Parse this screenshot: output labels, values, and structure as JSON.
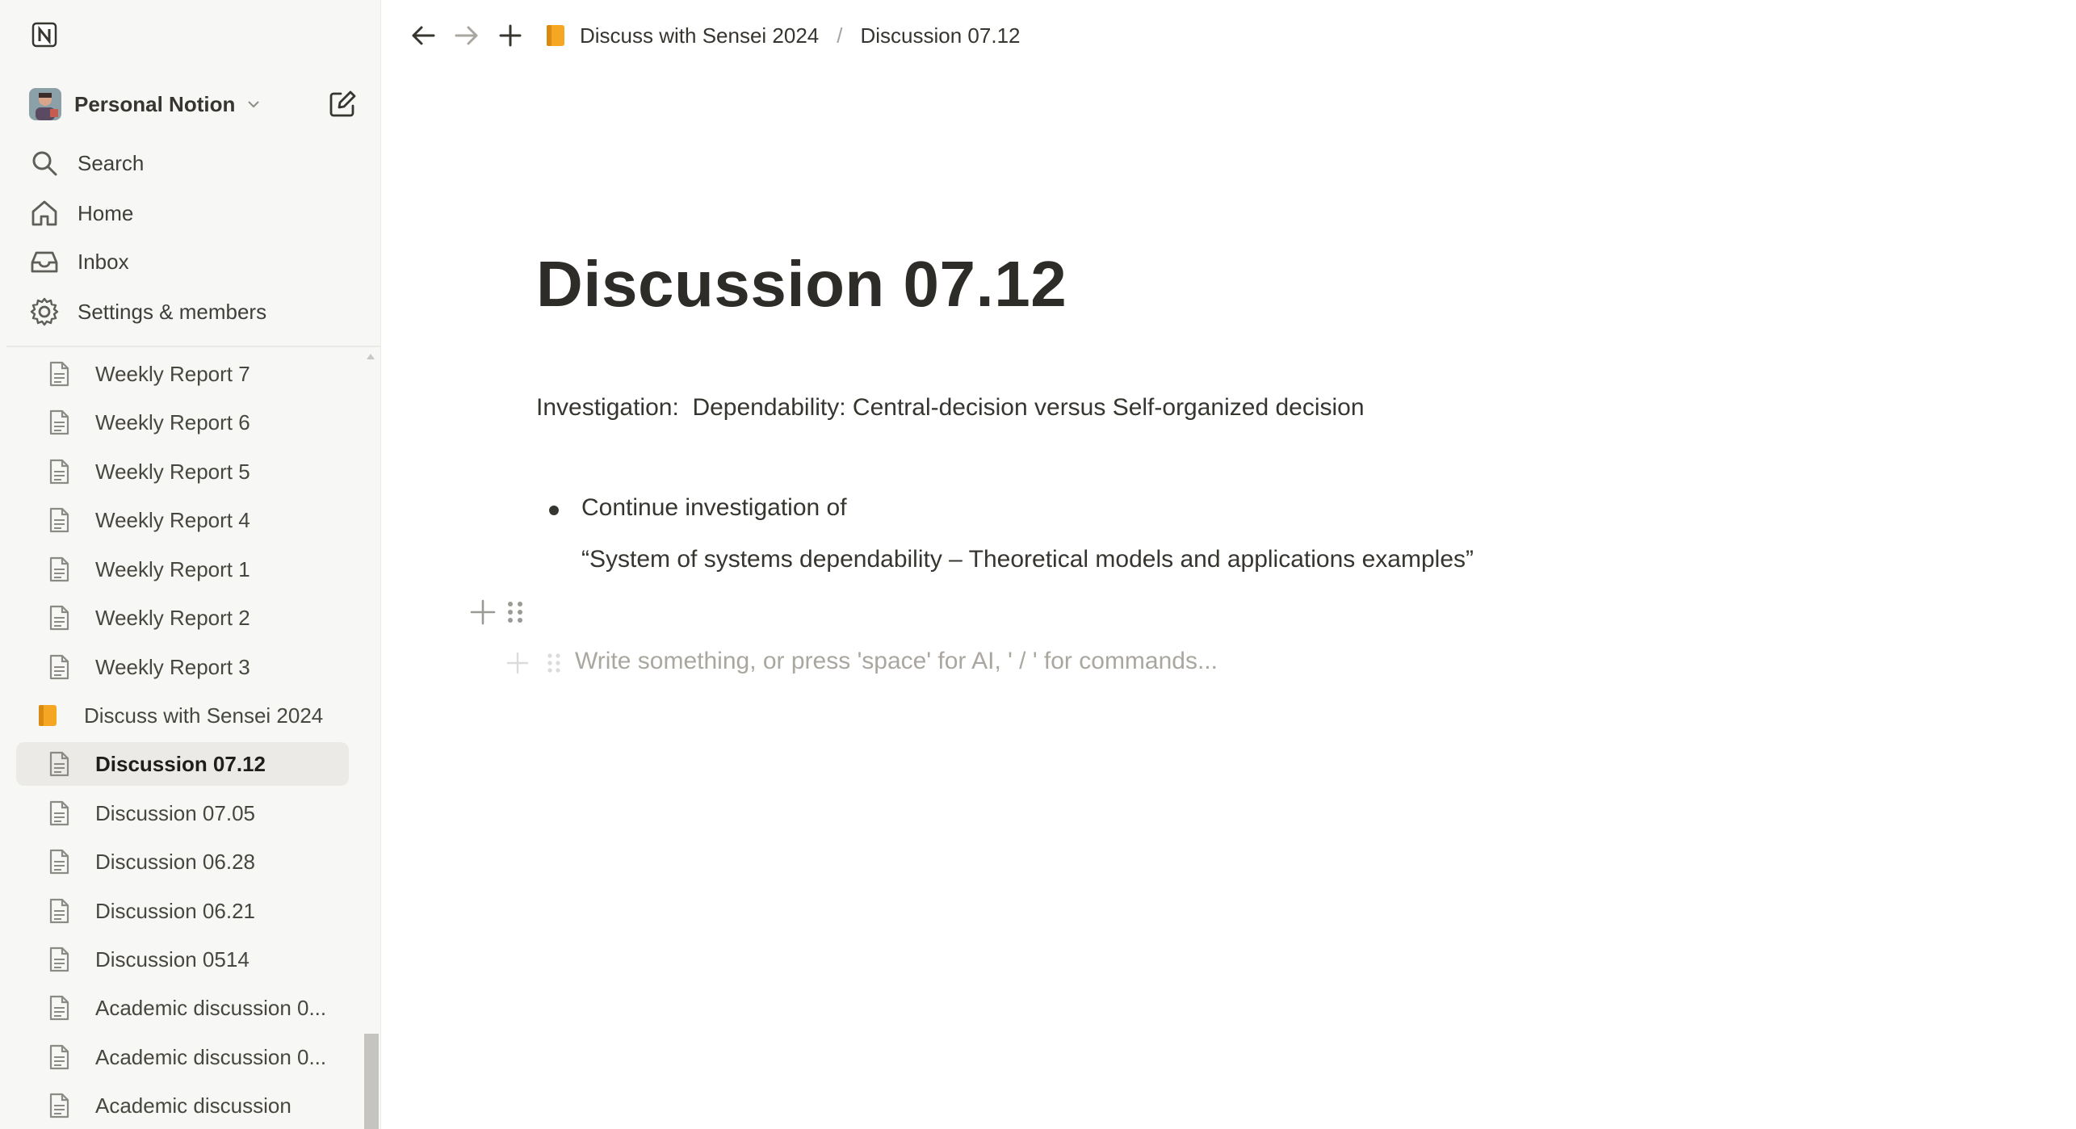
{
  "sidebar": {
    "workspace_name": "Personal Notion",
    "nav": [
      {
        "label": "Search",
        "icon": "search-icon"
      },
      {
        "label": "Home",
        "icon": "home-icon"
      },
      {
        "label": "Inbox",
        "icon": "inbox-icon"
      },
      {
        "label": "Settings & members",
        "icon": "gear-icon"
      }
    ],
    "pages": [
      {
        "label": "Weekly Report 7",
        "level": "child"
      },
      {
        "label": "Weekly Report 6",
        "level": "child"
      },
      {
        "label": "Weekly Report 5",
        "level": "child"
      },
      {
        "label": "Weekly Report 4",
        "level": "child"
      },
      {
        "label": "Weekly Report 1",
        "level": "child"
      },
      {
        "label": "Weekly Report 2",
        "level": "child"
      },
      {
        "label": "Weekly Report 3",
        "level": "child"
      },
      {
        "label": "Discuss with Sensei 2024",
        "level": "parent"
      },
      {
        "label": "Discussion 07.12",
        "level": "child",
        "active": true
      },
      {
        "label": "Discussion 07.05",
        "level": "child"
      },
      {
        "label": "Discussion 06.28",
        "level": "child"
      },
      {
        "label": "Discussion 06.21",
        "level": "child"
      },
      {
        "label": "Discussion 0514",
        "level": "child"
      },
      {
        "label": "Academic discussion 0...",
        "level": "child"
      },
      {
        "label": "Academic discussion 0...",
        "level": "child"
      },
      {
        "label": "Academic discussion",
        "level": "child"
      }
    ]
  },
  "topbar": {
    "breadcrumb": [
      "Discuss with Sensei 2024",
      "Discussion 07.12"
    ],
    "separator": "/"
  },
  "page": {
    "title": "Discussion 07.12",
    "paragraph": "Investigation:  Dependability: Central-decision versus Self-organized decision",
    "bullet": {
      "line1": "Continue investigation of",
      "line2": "“System of systems dependability – Theoretical models and applications examples”"
    },
    "placeholder": "Write something, or press 'space' for AI, ' / ' for commands..."
  },
  "colors": {
    "sidebar_bg": "#f7f7f5",
    "text": "#37352f",
    "active_bg": "#ebeae7",
    "folder_icon": "#f5a623"
  }
}
